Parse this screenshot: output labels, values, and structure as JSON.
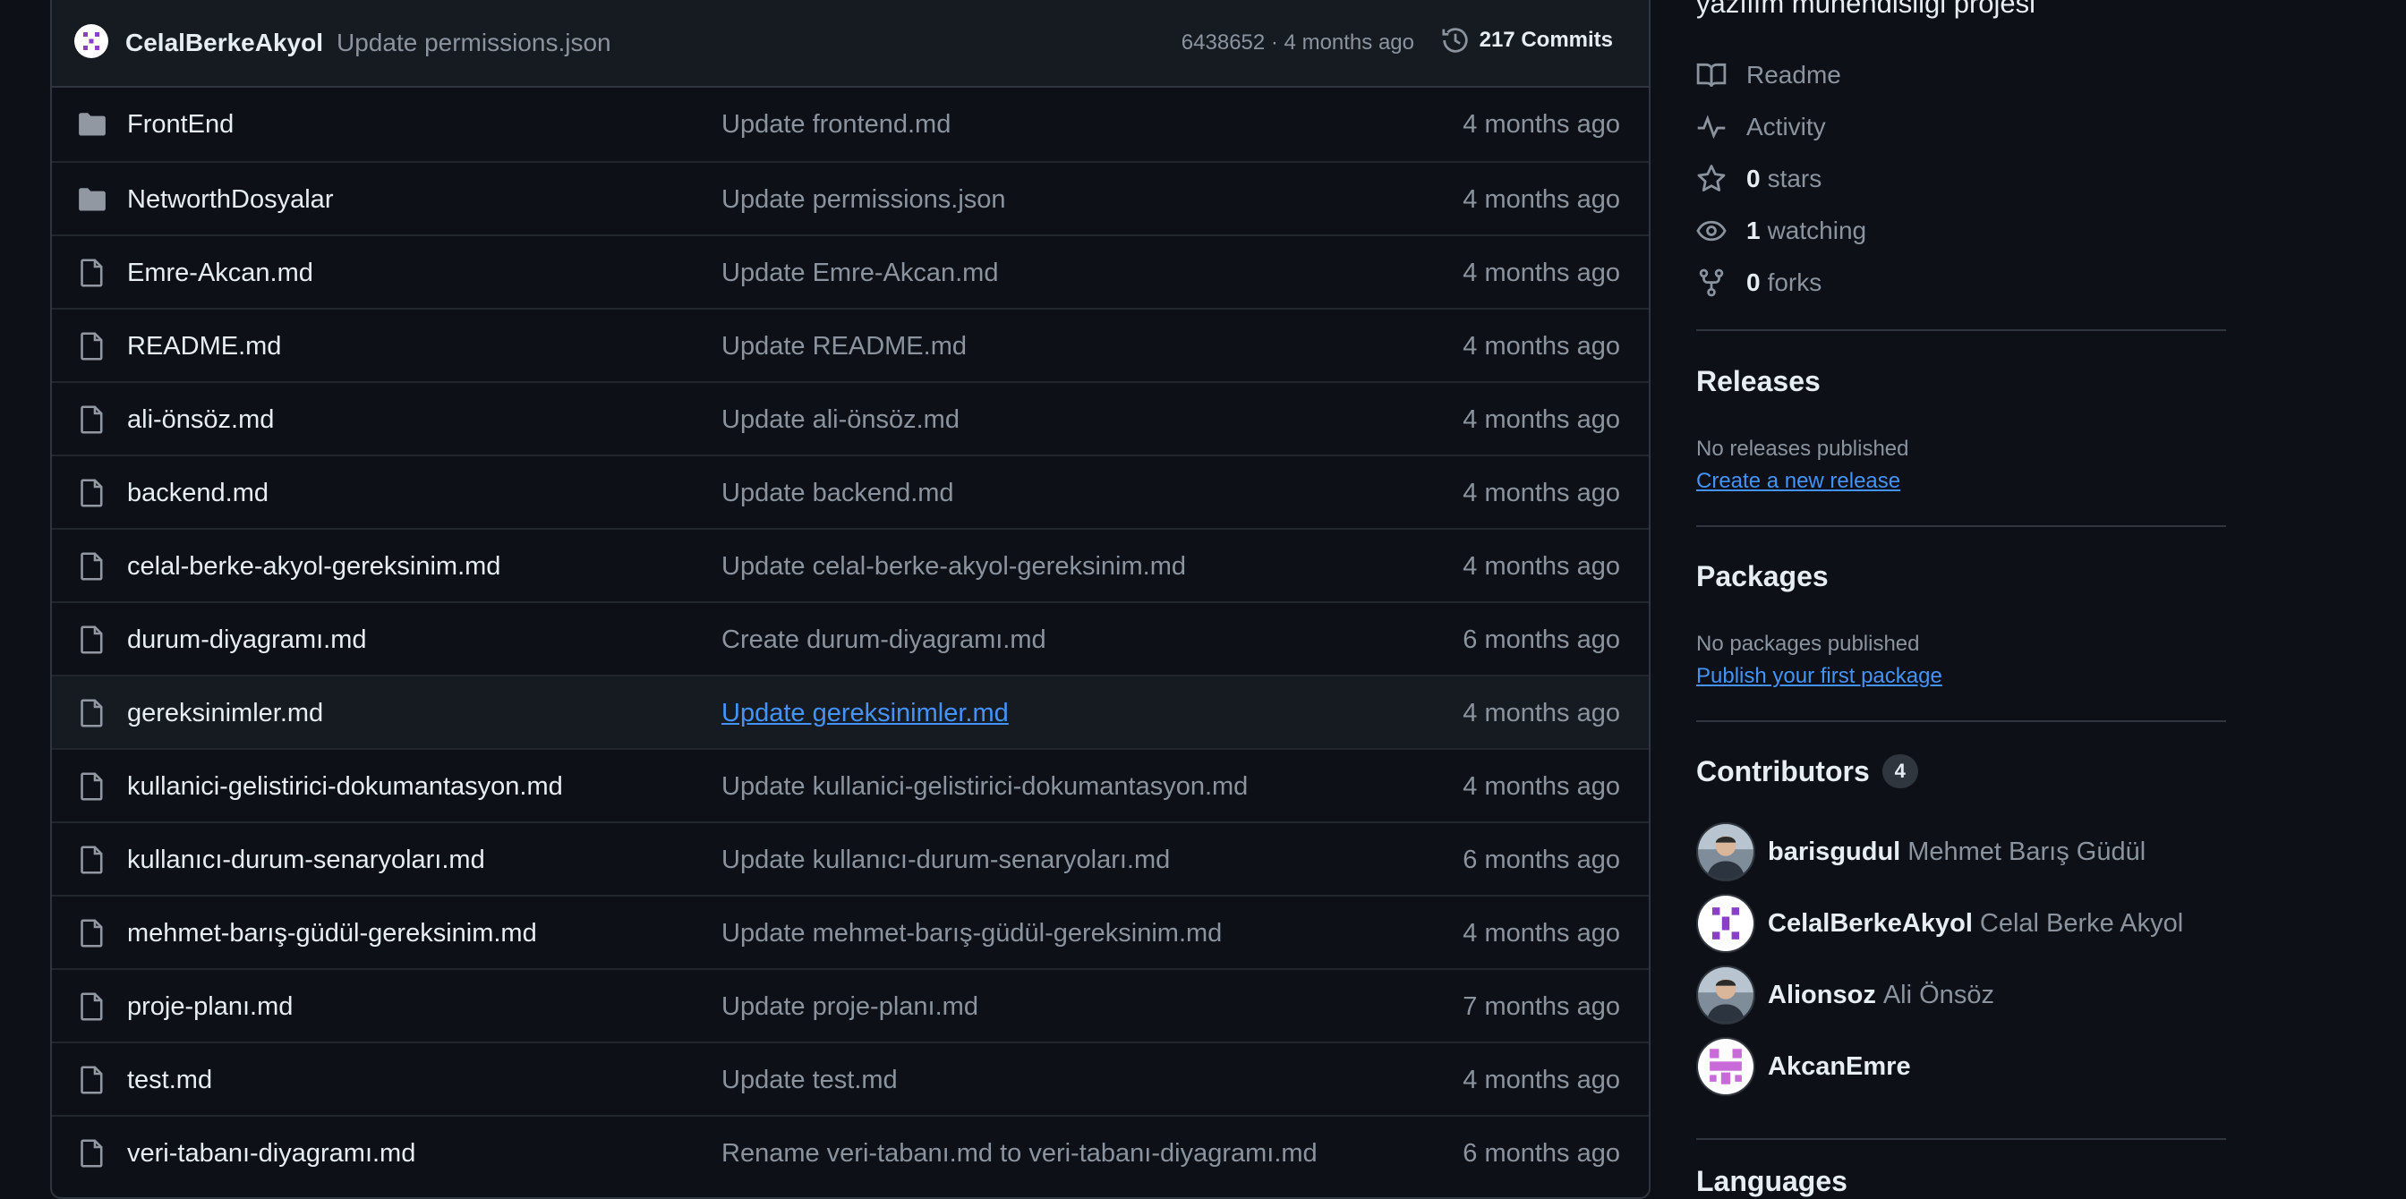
{
  "latest_commit": {
    "author": "CelalBerkeAkyol",
    "message": "Update permissions.json",
    "meta": "6438652 · 4 months ago",
    "commits_label": "217 Commits"
  },
  "files": [
    {
      "name": "FrontEnd",
      "type": "folder",
      "message": "Update frontend.md",
      "age": "4 months ago"
    },
    {
      "name": "NetworthDosyalar",
      "type": "folder",
      "message": "Update permissions.json",
      "age": "4 months ago"
    },
    {
      "name": "Emre-Akcan.md",
      "type": "file",
      "message": "Update Emre-Akcan.md",
      "age": "4 months ago"
    },
    {
      "name": "README.md",
      "type": "file",
      "message": "Update README.md",
      "age": "4 months ago"
    },
    {
      "name": "ali-önsöz.md",
      "type": "file",
      "message": "Update ali-önsöz.md",
      "age": "4 months ago"
    },
    {
      "name": "backend.md",
      "type": "file",
      "message": "Update backend.md",
      "age": "4 months ago"
    },
    {
      "name": "celal-berke-akyol-gereksinim.md",
      "type": "file",
      "message": "Update celal-berke-akyol-gereksinim.md",
      "age": "4 months ago"
    },
    {
      "name": "durum-diyagramı.md",
      "type": "file",
      "message": "Create durum-diyagramı.md",
      "age": "6 months ago"
    },
    {
      "name": "gereksinimler.md",
      "type": "file",
      "message": "Update gereksinimler.md",
      "age": "4 months ago",
      "hovered": true
    },
    {
      "name": "kullanici-gelistirici-dokumantasyon.md",
      "type": "file",
      "message": "Update kullanici-gelistirici-dokumantasyon.md",
      "age": "4 months ago"
    },
    {
      "name": "kullanıcı-durum-senaryoları.md",
      "type": "file",
      "message": "Update kullanıcı-durum-senaryoları.md",
      "age": "6 months ago"
    },
    {
      "name": "mehmet-barış-güdül-gereksinim.md",
      "type": "file",
      "message": "Update mehmet-barış-güdül-gereksinim.md",
      "age": "4 months ago"
    },
    {
      "name": "proje-planı.md",
      "type": "file",
      "message": "Update proje-planı.md",
      "age": "7 months ago"
    },
    {
      "name": "test.md",
      "type": "file",
      "message": "Update test.md",
      "age": "4 months ago"
    },
    {
      "name": "veri-tabanı-diyagramı.md",
      "type": "file",
      "message": "Rename veri-tabanı.md to veri-tabanı-diyagramı.md",
      "age": "6 months ago"
    }
  ],
  "sidebar": {
    "about_description": "yazılım mühendisliği projesi",
    "readme_label": "Readme",
    "activity_label": "Activity",
    "stars_count": "0",
    "stars_label": "stars",
    "watching_count": "1",
    "watching_label": "watching",
    "forks_count": "0",
    "forks_label": "forks",
    "releases_title": "Releases",
    "releases_none": "No releases published",
    "releases_link": "Create a new release",
    "packages_title": "Packages",
    "packages_none": "No packages published",
    "packages_link": "Publish your first package",
    "contributors_title": "Contributors",
    "contributors_count": "4",
    "contributors": [
      {
        "login": "barisgudul",
        "name": "Mehmet Barış Güdül",
        "avatar": "photo-person"
      },
      {
        "login": "CelalBerkeAkyol",
        "name": "Celal Berke Akyol",
        "avatar": "identicon-purple"
      },
      {
        "login": "Alionsoz",
        "name": "Ali Önsöz",
        "avatar": "photo-person"
      },
      {
        "login": "AkcanEmre",
        "name": "",
        "avatar": "identicon-pink"
      }
    ],
    "languages_title": "Languages"
  },
  "colors": {
    "background": "#0d1117",
    "panel": "#161b22",
    "border": "#30363d",
    "text": "#e6edf3",
    "muted": "#8b949e",
    "link": "#4493f8",
    "identicon_purple": "#8a3fc7",
    "identicon_pink": "#c86bd8"
  }
}
